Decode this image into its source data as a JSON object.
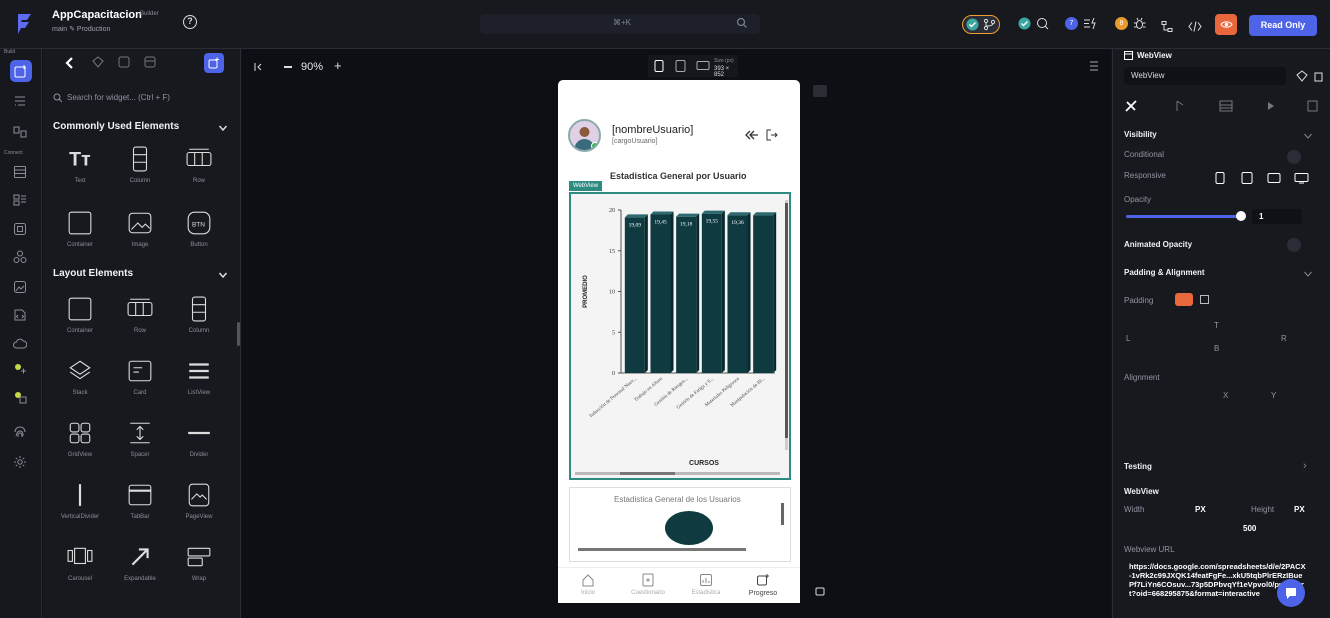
{
  "topbar": {
    "app_title": "AppCapacitacion",
    "app_badge": "Builder",
    "branch": "main ✎ Production",
    "cmdk": "⌘+K",
    "read_only": "Read Only",
    "badge_count_blue": "7",
    "badge_count_orange": "8"
  },
  "rail": {
    "build_label": "Build",
    "connect_label": "Connect"
  },
  "panel": {
    "search_placeholder": "Search for widget... (Ctrl + F)",
    "common_title": "Commonly Used Elements",
    "layout_title": "Layout Elements",
    "common_items": [
      "Text",
      "Column",
      "Row",
      "Container",
      "Image",
      "Button"
    ],
    "layout_items": [
      "Container",
      "Row",
      "Column",
      "Stack",
      "Card",
      "ListView",
      "GridView",
      "Spacer",
      "Divider",
      "VerticalDivider",
      "TabBar",
      "PageView",
      "Carousel",
      "Expandable",
      "Wrap"
    ]
  },
  "canvas": {
    "zoom": "90%",
    "size_label": "Size (px)",
    "size_value": "393 × 852"
  },
  "phone": {
    "user_name": "[nombreUsuario]",
    "user_role": "[cargoUsuario]",
    "stat_title": "Estadistica General por Usuario",
    "webview_tag": "WebView",
    "card2_title": "Estadistica General de los Usuarios",
    "nav": [
      "Inicio",
      "Cuestionario",
      "Estadistica",
      "Progreso"
    ]
  },
  "chart_data": {
    "type": "bar",
    "categories": [
      "Inducción de Personal Nuev...",
      "Trabajo en Altura",
      "Gestión de Riesgos...",
      "Gestión de Fatiga y S...",
      "Materiales Peligrosos",
      "Manipulación de Bl..."
    ],
    "values": [
      19.09,
      19.45,
      19.18,
      19.55,
      19.36,
      19.36
    ],
    "value_labels": [
      "19,09",
      "19,45",
      "19,18",
      "19,55",
      "19,36",
      ""
    ],
    "ylabel": "PROMEDIO",
    "xlabel": "CURSOS",
    "y_ticks": [
      "0",
      "5",
      "10",
      "15",
      "20"
    ],
    "ylim": [
      0,
      20
    ],
    "bar_color": "#0f3b40"
  },
  "props": {
    "title": "WebView",
    "name_value": "WebView",
    "visibility": "Visibility",
    "conditional": "Conditional",
    "responsive": "Responsive",
    "opacity": "Opacity",
    "opacity_value": "1",
    "animated_opacity": "Animated Opacity",
    "padding_alignment": "Padding & Alignment",
    "padding": "Padding",
    "pad_t": "T",
    "pad_l": "L",
    "pad_r": "R",
    "pad_b": "B",
    "alignment": "Alignment",
    "align_x": "X",
    "align_y": "Y",
    "testing": "Testing",
    "webview_section": "WebView",
    "width_label": "Width",
    "height_label": "Height",
    "px": "PX",
    "height_value": "500",
    "url_label": "Webview URL",
    "url_value": "https://docs.google.com/spreadsheets/d/e/2PACX-1vRk2c99JXQK14featFgFe...xkU5tqbPlrERzIBuePf7LiYn6COsuv...73p5DPbvqYf1eVpvol0/pubchart?oid=668295875&format=interactive"
  }
}
